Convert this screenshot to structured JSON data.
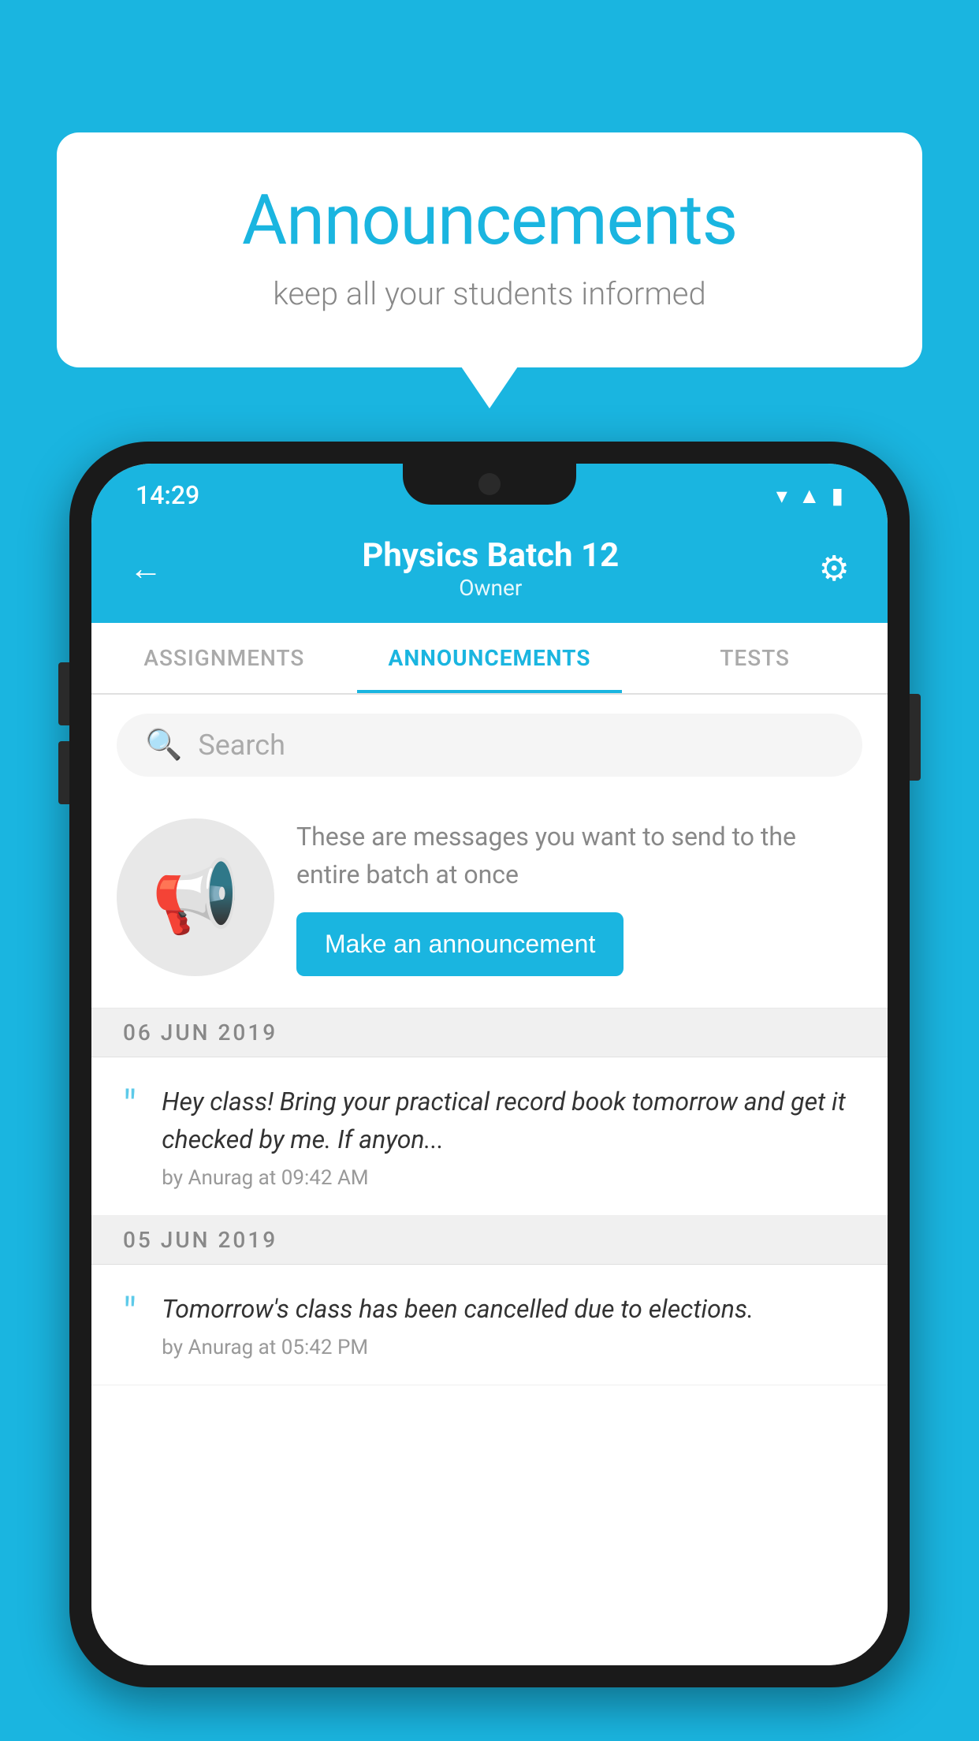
{
  "background_color": "#1ab5e0",
  "speech_bubble": {
    "title": "Announcements",
    "subtitle": "keep all your students informed"
  },
  "phone": {
    "status_bar": {
      "time": "14:29",
      "wifi": "▼",
      "signal": "▲",
      "battery": "▐"
    },
    "header": {
      "title": "Physics Batch 12",
      "subtitle": "Owner",
      "back_label": "←",
      "gear_label": "⚙"
    },
    "tabs": [
      {
        "label": "ASSIGNMENTS",
        "active": false
      },
      {
        "label": "ANNOUNCEMENTS",
        "active": true
      },
      {
        "label": "TESTS",
        "active": false
      }
    ],
    "search": {
      "placeholder": "Search"
    },
    "promo": {
      "description": "These are messages you want to send to the entire batch at once",
      "button_label": "Make an announcement"
    },
    "announcements": [
      {
        "date": "06  JUN  2019",
        "text": "Hey class! Bring your practical record book tomorrow and get it checked by me. If anyon...",
        "meta": "by Anurag at 09:42 AM"
      },
      {
        "date": "05  JUN  2019",
        "text": "Tomorrow's class has been cancelled due to elections.",
        "meta": "by Anurag at 05:42 PM"
      }
    ]
  }
}
